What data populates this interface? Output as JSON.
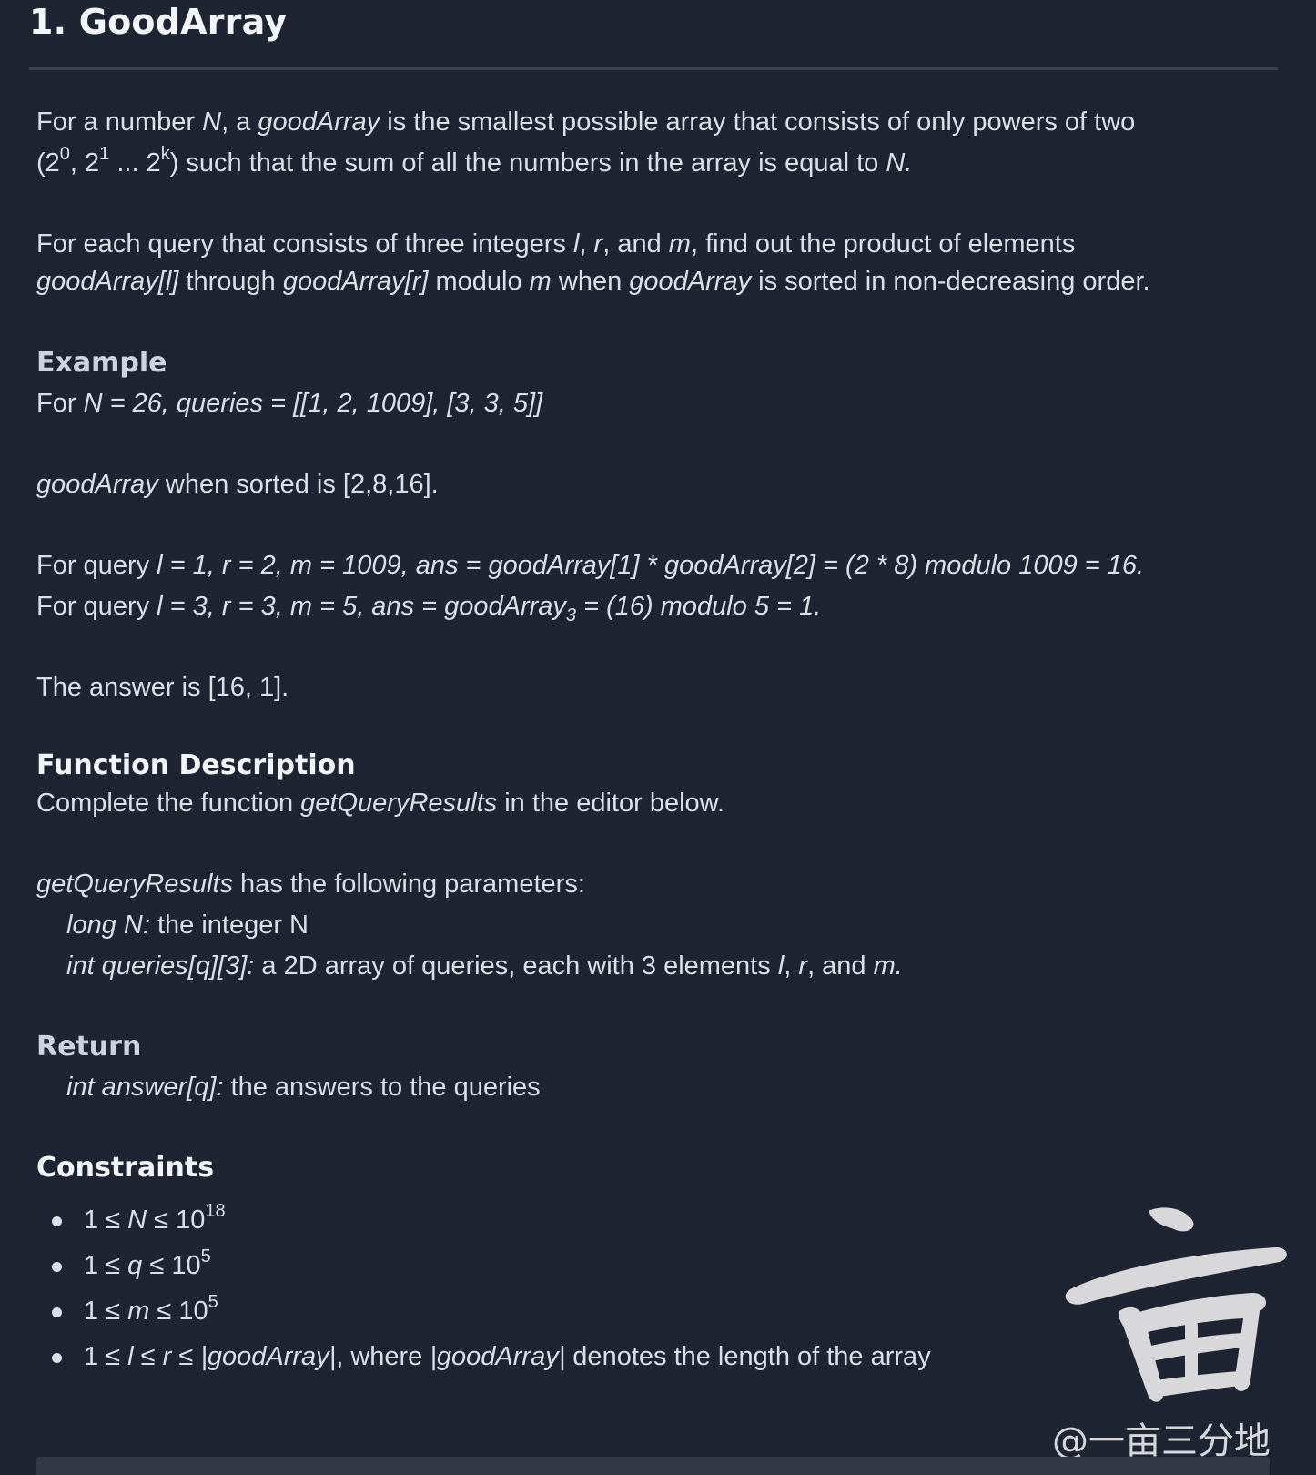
{
  "title": "1. GoodArray",
  "intro": {
    "s1": "For a number ",
    "n": "N",
    "s2": ", a ",
    "good_array": "goodArray",
    "s3": " is the smallest possible array that consists of only powers of two",
    "s4": "(2",
    "sup0": "0",
    "s5": ", 2",
    "sup1": "1",
    "s6": " ... 2",
    "supk": "k",
    "s7": ") such that the sum of all the numbers in the array is equal to ",
    "n2": "N."
  },
  "query_desc": {
    "s1": "For each query that consists of three integers ",
    "l": "l",
    "c1": ", ",
    "r": "r",
    "c2": ", and ",
    "m": "m",
    "s2": ", find out the product of elements",
    "ga_l": "goodArray[l]",
    "through": " through ",
    "ga_r": "goodArray[r]",
    "modulo": " modulo ",
    "m2": "m",
    "when": " when ",
    "ga": "goodArray",
    "s3": " is sorted in non-decreasing order."
  },
  "example": {
    "heading": "Example",
    "for": "For ",
    "input": "N = 26, queries = [[1, 2, 1009], [3, 3, 5]]",
    "ga": "goodArray",
    "sorted": " when sorted is [2,8,16].",
    "q_prefix": "For query ",
    "q1": "l = 1, r = 2, m = 1009, ans = goodArray[1] * goodArray[2] = (2 * 8) modulo 1009 = 16.",
    "q2a": "l = 3, r = 3, m = 5, ans = goodArray",
    "q2sub": "3",
    "q2b": " = (16) modulo 5 = 1.",
    "answer": "The answer is [16, 1]."
  },
  "function_description": {
    "heading": "Function Description",
    "s1": "Complete the function ",
    "fn": "getQueryResults",
    "s2": " in the editor below.",
    "fn2": "getQueryResults",
    "params_intro": " has the following parameters:",
    "p1_name": "long N:",
    "p1_desc": " the integer N",
    "p2_name": "int queries[q][3]:",
    "p2_desc": "  a 2D array of queries, each with 3 elements ",
    "p2_l": "l",
    "p2_c1": ", ",
    "p2_r": "r",
    "p2_c2": ", and ",
    "p2_m": "m",
    "p2_end": "."
  },
  "return": {
    "heading": "Return",
    "name": "int answer[q]:",
    "desc": " the answers to the queries"
  },
  "constraints": {
    "heading": "Constraints",
    "c1a": "1 ≤ ",
    "c1v": "N",
    "c1b": " ≤ 10",
    "c1sup": "18",
    "c2a": "1 ≤ ",
    "c2v": "q",
    "c2b": " ≤ 10",
    "c2sup": "5",
    "c3a": "1 ≤ ",
    "c3v": "m",
    "c3b": " ≤ 10",
    "c3sup": "5",
    "c4a": "1 ≤ ",
    "c4v": "l ≤ r ≤ |goodArray|",
    "c4b": ", where ",
    "c4v2": "|goodArray|",
    "c4c": " denotes the length of the array"
  },
  "watermark": {
    "glyph": "亩",
    "text": "@一亩三分地"
  }
}
